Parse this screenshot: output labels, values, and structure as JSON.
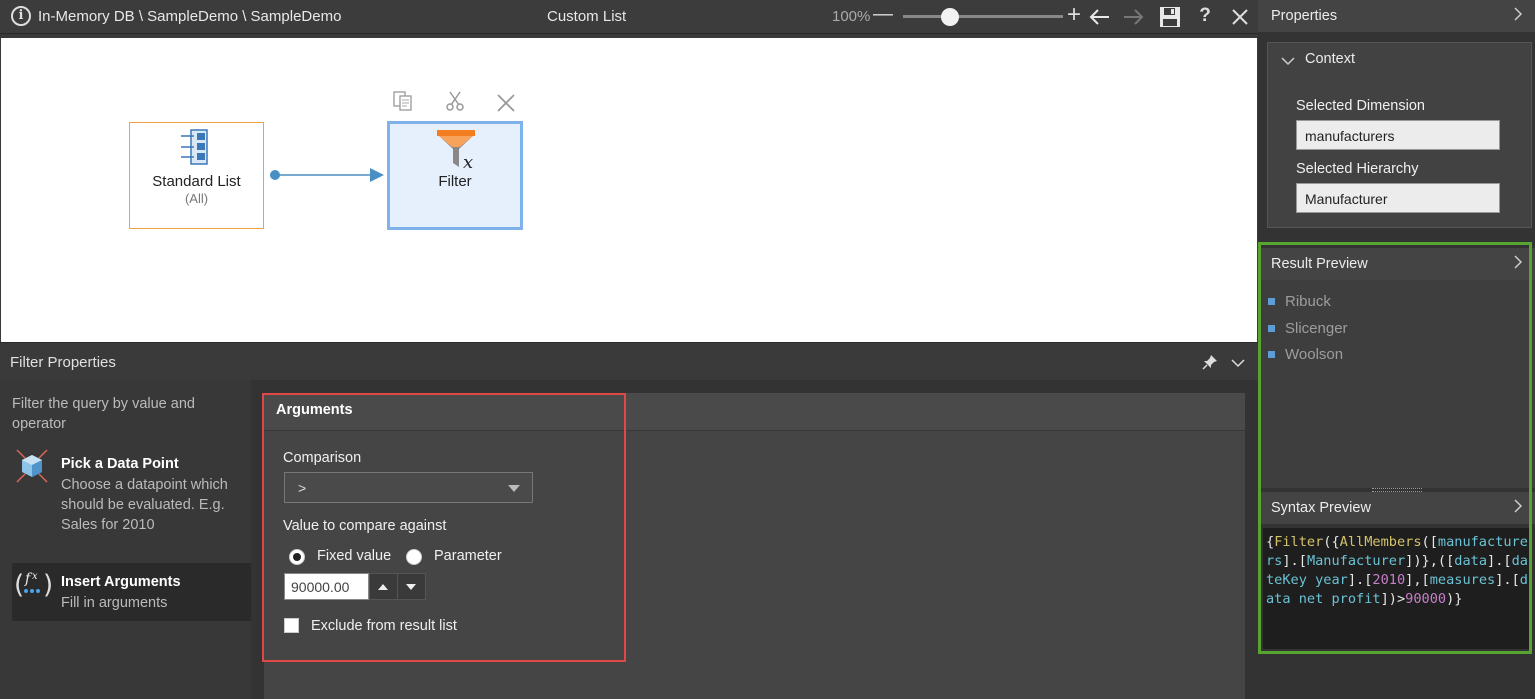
{
  "titlebar": {
    "path": "In-Memory DB \\ SampleDemo \\ SampleDemo",
    "title": "Custom List",
    "zoom": "100%",
    "icons": [
      "info-icon",
      "zoom-out-icon",
      "zoom-in-icon",
      "undo-icon",
      "redo-icon",
      "save-icon",
      "help-icon",
      "close-icon"
    ]
  },
  "canvas": {
    "nodes": [
      {
        "label": "Standard List",
        "sublabel": "(All)"
      },
      {
        "label": "Filter",
        "sublabel": ""
      }
    ],
    "tools": [
      "copy-icon",
      "cut-icon",
      "delete-icon"
    ]
  },
  "filter_properties": {
    "title": "Filter Properties",
    "description": "Filter the query by value and operator",
    "steps": [
      {
        "title": "Pick a Data Point",
        "description": "Choose a datapoint which should be evaluated. E.g. Sales for 2010"
      },
      {
        "title": "Insert Arguments",
        "description": "Fill in arguments"
      }
    ],
    "arguments": {
      "title": "Arguments",
      "comparison_label": "Comparison",
      "comparison_value": ">",
      "compare_label": "Value to compare against",
      "radio_fixed": "Fixed value",
      "radio_param": "Parameter",
      "value": "90000.00",
      "exclude_label": "Exclude from result list"
    }
  },
  "properties": {
    "title": "Properties",
    "context": {
      "title": "Context",
      "dimension_label": "Selected Dimension",
      "dimension_value": "manufacturers",
      "hierarchy_label": "Selected Hierarchy",
      "hierarchy_value": "Manufacturer"
    }
  },
  "result_preview": {
    "title": "Result Preview",
    "items": [
      "Ribuck",
      "Slicenger",
      "Woolson"
    ]
  },
  "syntax_preview": {
    "title": "Syntax Preview",
    "tokens": [
      {
        "t": "{",
        "c": "c-br"
      },
      {
        "t": "Filter",
        "c": "c-fn"
      },
      {
        "t": "({",
        "c": "c-br"
      },
      {
        "t": "AllMembers",
        "c": "c-fn"
      },
      {
        "t": "([",
        "c": "c-br"
      },
      {
        "t": "manufacturers",
        "c": "c-id"
      },
      {
        "t": "].[",
        "c": "c-br"
      },
      {
        "t": "Manufacturer",
        "c": "c-id"
      },
      {
        "t": "])},([",
        "c": "c-br"
      },
      {
        "t": "data",
        "c": "c-id"
      },
      {
        "t": "].[",
        "c": "c-br"
      },
      {
        "t": "dateKey year",
        "c": "c-id"
      },
      {
        "t": "].[",
        "c": "c-br"
      },
      {
        "t": "2010",
        "c": "c-num"
      },
      {
        "t": "],[",
        "c": "c-br"
      },
      {
        "t": "measures",
        "c": "c-id"
      },
      {
        "t": "].[",
        "c": "c-br"
      },
      {
        "t": "data net profit",
        "c": "c-id"
      },
      {
        "t": "])>",
        "c": "c-br"
      },
      {
        "t": "90000",
        "c": "c-num"
      },
      {
        "t": ")}",
        "c": "c-br"
      }
    ]
  }
}
